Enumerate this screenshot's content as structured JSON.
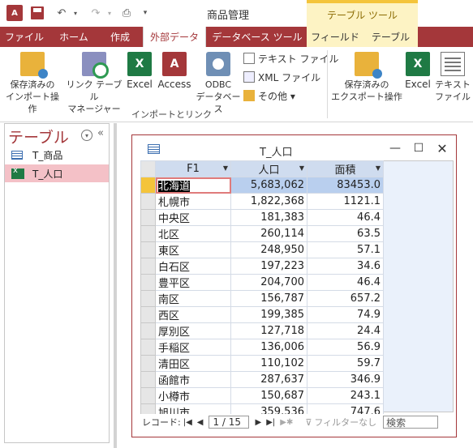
{
  "app": {
    "title": "商品管理",
    "context_tools": "テーブル ツール",
    "app_icon": "A"
  },
  "tabs": [
    {
      "label": "ファイル"
    },
    {
      "label": "ホーム"
    },
    {
      "label": "作成"
    },
    {
      "label": "外部データ"
    },
    {
      "label": "データベース ツール"
    },
    {
      "label": "フィールド"
    },
    {
      "label": "テーブル"
    }
  ],
  "ribbon": {
    "saved_import": "保存済みの\nインポート操作",
    "link_table_manager": "リンク テーブル\nマネージャー",
    "excel": "Excel",
    "access": "Access",
    "odbc": "ODBC\nデータベース",
    "text_file": "テキスト ファイル",
    "xml_file": "XML ファイル",
    "other": "その他 ▾",
    "group_import": "インポートとリンク",
    "saved_export": "保存済みの\nエクスポート操作",
    "excel_export": "Excel",
    "text_file_export": "テキスト\nファイル"
  },
  "nav": {
    "title": "テーブル",
    "items": [
      {
        "label": "T_商品"
      },
      {
        "label": "T_人口"
      }
    ]
  },
  "datasheet": {
    "title": "T_人口",
    "columns": [
      "F1",
      "人口",
      "面積"
    ],
    "rows": [
      [
        "北海道",
        "5,683,062",
        "83453.0"
      ],
      [
        "札幌市",
        "1,822,368",
        "1121.1"
      ],
      [
        "中央区",
        "181,383",
        "46.4"
      ],
      [
        "北区",
        "260,114",
        "63.5"
      ],
      [
        "東区",
        "248,950",
        "57.1"
      ],
      [
        "白石区",
        "197,223",
        "34.6"
      ],
      [
        "豊平区",
        "204,700",
        "46.4"
      ],
      [
        "南区",
        "156,787",
        "657.2"
      ],
      [
        "西区",
        "199,385",
        "74.9"
      ],
      [
        "厚別区",
        "127,718",
        "24.4"
      ],
      [
        "手稲区",
        "136,006",
        "56.9"
      ],
      [
        "清田区",
        "110,102",
        "59.7"
      ],
      [
        "函館市",
        "287,637",
        "346.9"
      ],
      [
        "小樽市",
        "150,687",
        "243.1"
      ],
      [
        "旭川市",
        "359,536",
        "747.6"
      ]
    ],
    "record_label": "レコード:",
    "record_position": "1 / 15",
    "filter_label": "フィルターなし",
    "search_placeholder": "検索"
  }
}
